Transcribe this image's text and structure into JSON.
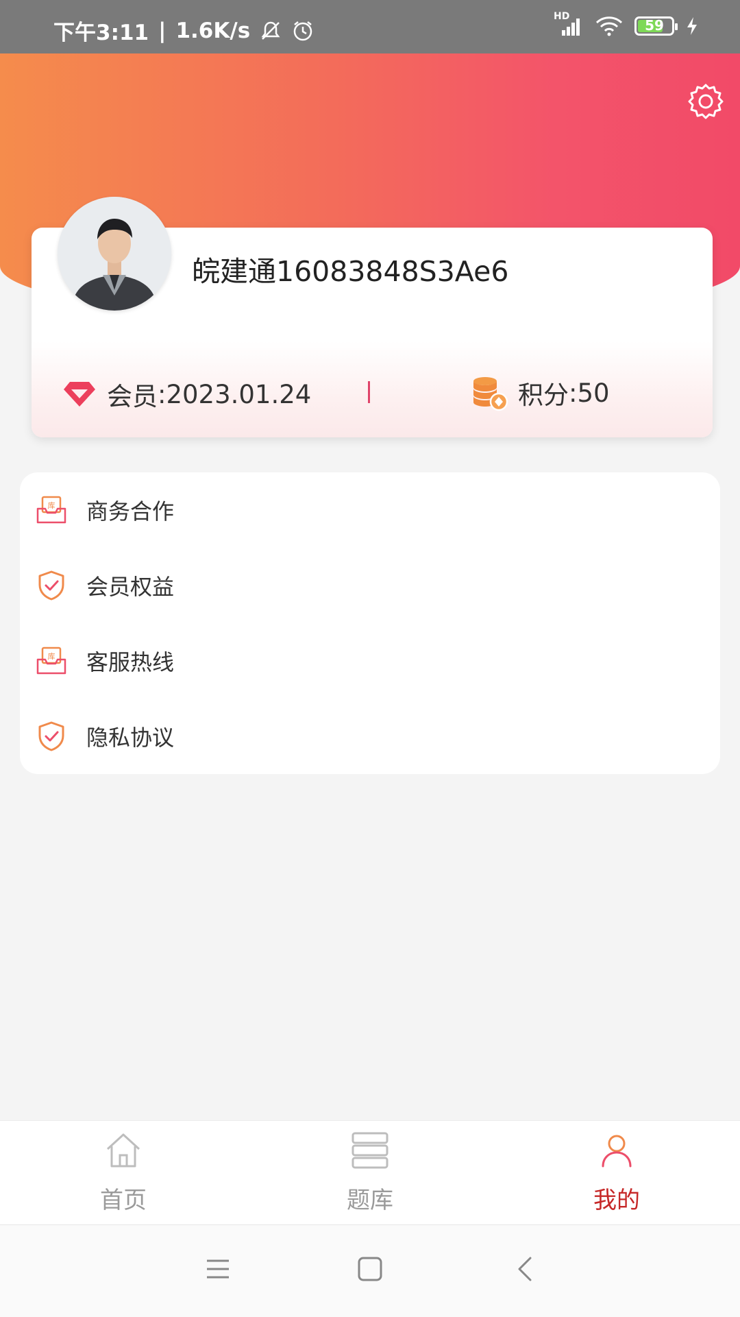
{
  "status_bar": {
    "time": "下午3:11",
    "speed": "1.6K/s",
    "network": "HD",
    "battery": "59"
  },
  "profile": {
    "username": "皖建通16083848S3Ae6",
    "member_label": "会员",
    "member_date": "2023.01.24",
    "points_label": "积分",
    "points_value": "50"
  },
  "menu": {
    "items": [
      {
        "label": "商务合作",
        "icon": "inbox-icon"
      },
      {
        "label": "会员权益",
        "icon": "shield-check-icon"
      },
      {
        "label": "客服热线",
        "icon": "inbox-icon"
      },
      {
        "label": "隐私协议",
        "icon": "shield-check-icon"
      }
    ]
  },
  "bottom_nav": {
    "tabs": [
      {
        "label": "首页",
        "icon": "home-icon"
      },
      {
        "label": "题库",
        "icon": "question-bank-icon"
      },
      {
        "label": "我的",
        "icon": "person-icon",
        "active": true
      }
    ]
  },
  "colors": {
    "header_start": "#f58c4c",
    "header_end": "#f24a68",
    "accent": "#c62828",
    "icon_orange": "#f08a4b",
    "icon_pink": "#ec4e6a"
  }
}
